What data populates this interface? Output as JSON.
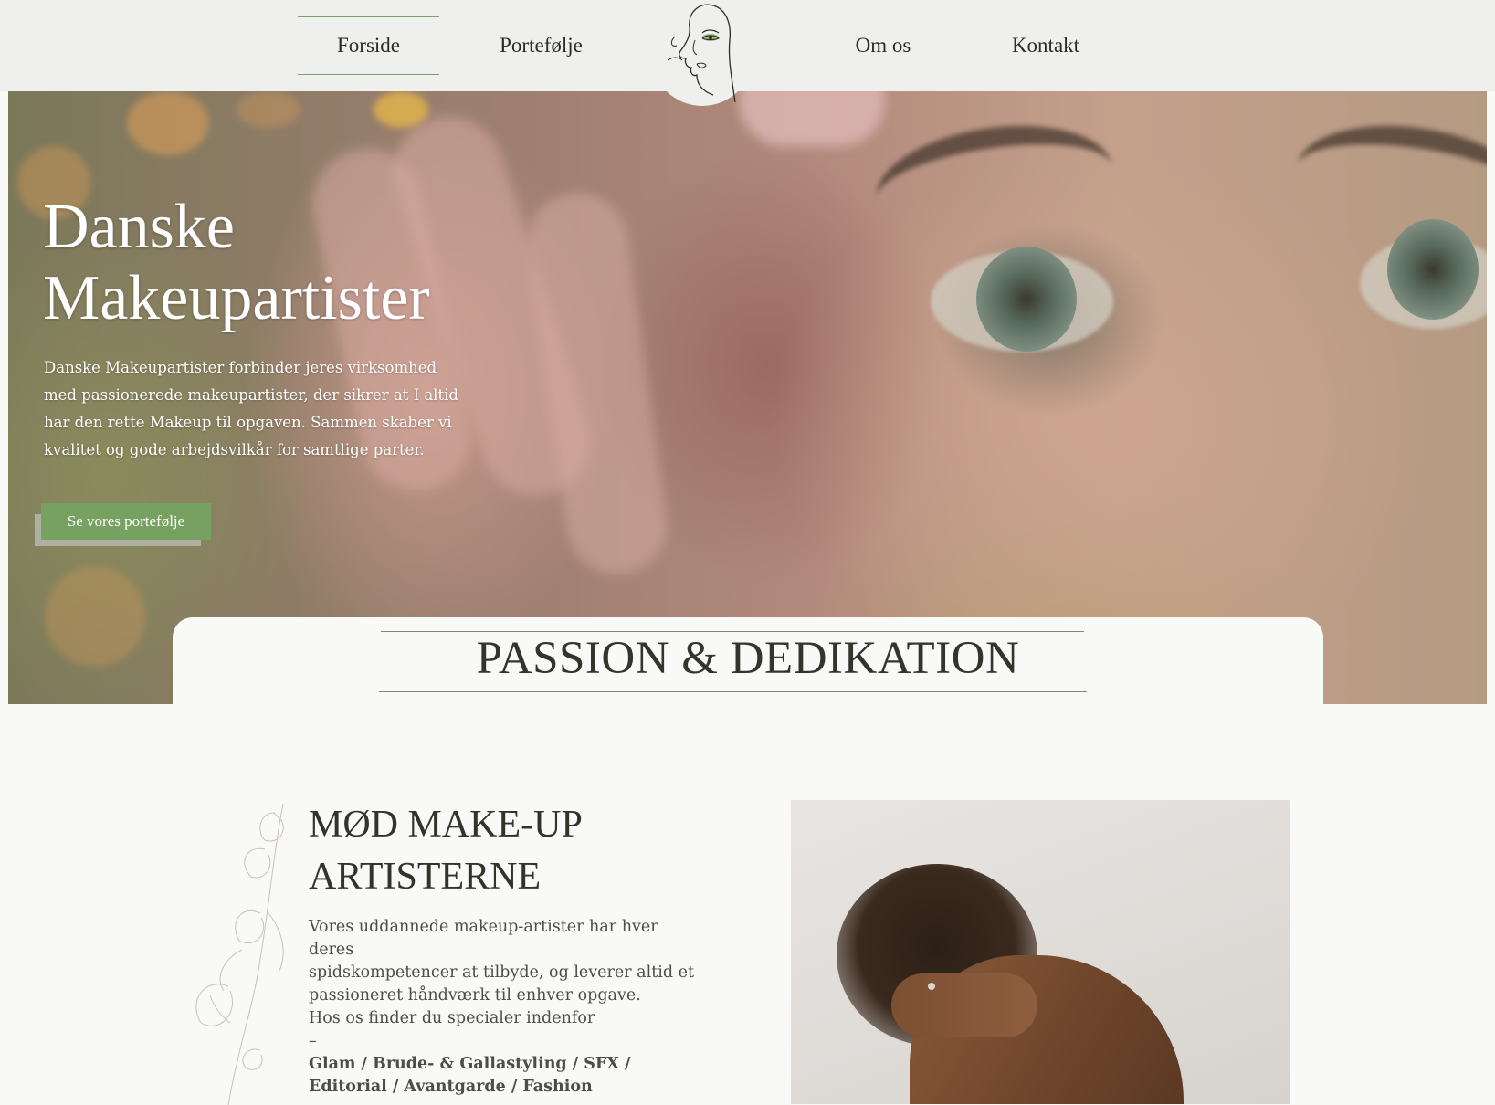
{
  "nav": {
    "items": [
      {
        "label": "Forside",
        "active": true
      },
      {
        "label": "Portefølje",
        "active": false
      },
      {
        "label": "Om os",
        "active": false
      },
      {
        "label": "Kontakt",
        "active": false
      }
    ],
    "logo_icon": "face-line-art-logo-icon",
    "accent_color": "#76a160"
  },
  "hero": {
    "title_line1": "Danske",
    "title_line2": "Makeupartister",
    "description": "Danske Makeupartister forbinder jeres virksomhed med passionerede makeupartister, der sikrer at I altid har den rette Makeup til opgaven. Sammen skaber vi kvalitet og gode arbejdsvilkår for samtlige parter.",
    "cta_label": "Se vores portefølje"
  },
  "section": {
    "title": "PASSION & DEDIKATION"
  },
  "meet": {
    "title_line1": "MØD MAKE-UP",
    "title_line2": "ARTISTERNE",
    "body_lines": [
      "Vores uddannede makeup-artister har hver deres",
      "spidskompetencer at tilbyde, og leverer altid et",
      "passioneret håndværk til enhver opgave.",
      "Hos os finder du specialer indenfor",
      "–"
    ],
    "specialties_line1": "Glam / Brude- & Gallastyling / SFX /",
    "specialties_line2": "Editorial / Avantgarde / Fashion"
  }
}
